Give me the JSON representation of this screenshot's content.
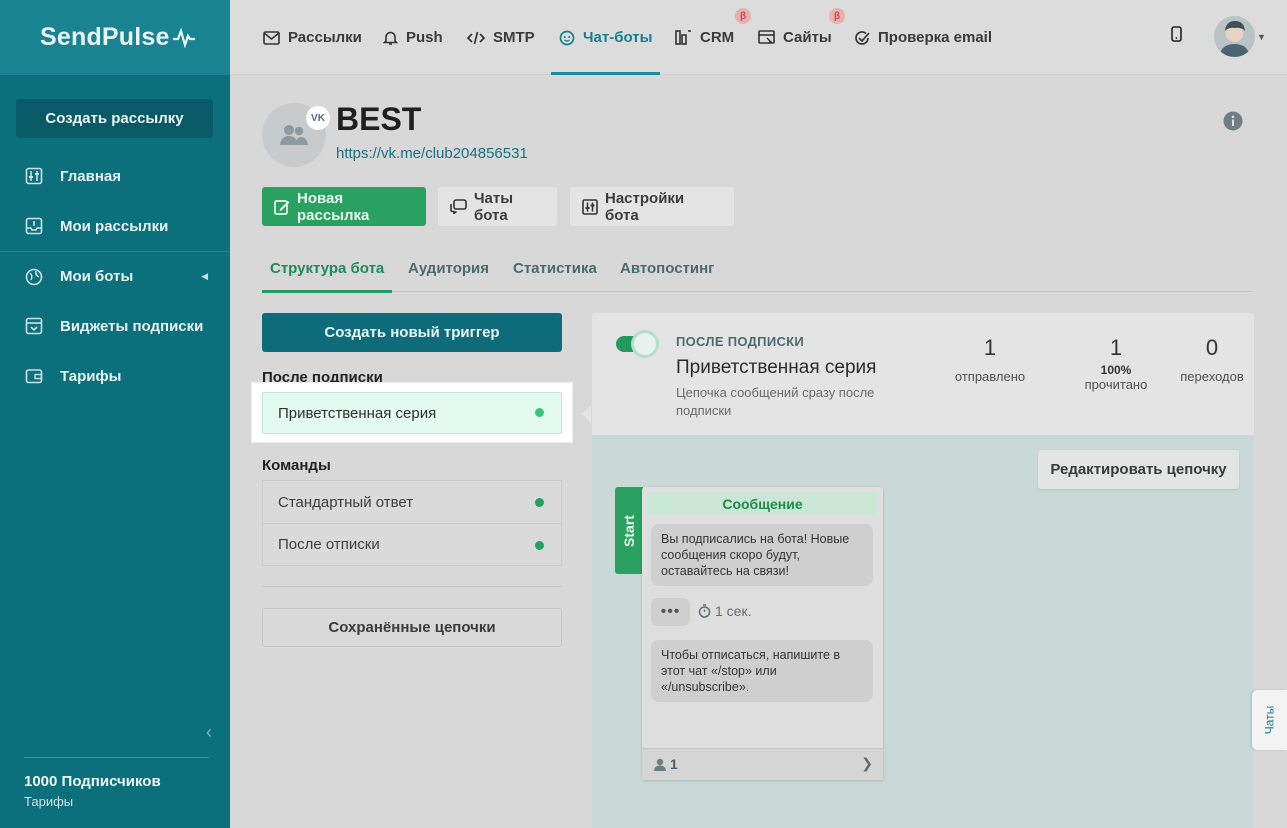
{
  "sidebar": {
    "logo": "SendPulse",
    "create_button": "Создать рассылку",
    "items": [
      {
        "label": "Главная",
        "icon": "sliders-icon"
      },
      {
        "label": "Мои рассылки",
        "icon": "inbox-icon"
      },
      {
        "label": "Мои боты",
        "icon": "globe-icon"
      },
      {
        "label": "Виджеты подписки",
        "icon": "widget-icon"
      },
      {
        "label": "Тарифы",
        "icon": "wallet-icon"
      }
    ],
    "subscribers": "1000 Подписчиков",
    "plan_link": "Тарифы"
  },
  "topnav": {
    "items": [
      {
        "label": "Рассылки",
        "icon": "mail-icon"
      },
      {
        "label": "Push",
        "icon": "bell-icon"
      },
      {
        "label": "SMTP",
        "icon": "code-icon"
      },
      {
        "label": "Чат-боты",
        "icon": "chatbot-icon",
        "active": true
      },
      {
        "label": "CRM",
        "icon": "crm-icon",
        "beta": "β"
      },
      {
        "label": "Сайты",
        "icon": "site-icon",
        "beta": "β"
      },
      {
        "label": "Проверка email",
        "icon": "check-icon"
      }
    ]
  },
  "bot": {
    "name": "BEST",
    "link": "https://vk.me/club204856531",
    "network_badge": "VK"
  },
  "actions": {
    "new_campaign": "Новая рассылка",
    "bot_chats": "Чаты бота",
    "bot_settings": "Настройки бота"
  },
  "tabs": [
    "Структура бота",
    "Аудитория",
    "Статистика",
    "Автопостинг"
  ],
  "triggers": {
    "create_button": "Создать новый триггер",
    "after_subscribe_label": "После подписки",
    "after_subscribe_items": [
      "Приветственная серия"
    ],
    "commands_label": "Команды",
    "commands_items": [
      "Стандартный ответ",
      "После отписки"
    ],
    "saved_chains": "Сохранённые цепочки"
  },
  "panel": {
    "caption": "ПОСЛЕ ПОДПИСКИ",
    "title": "Приветственная серия",
    "description": "Цепочка сообщений сразу после подписки",
    "stats": [
      {
        "value": "1",
        "label": "отправлено"
      },
      {
        "value": "1",
        "pct": "100%",
        "label": "прочитано"
      },
      {
        "value": "0",
        "label": "переходов"
      }
    ],
    "edit_button": "Редактировать цепочку",
    "start_label": "Start",
    "card": {
      "header": "Сообщение",
      "message1": "Вы подписались на бота! Новые сообщения скоро будут, оставайтесь на связи!",
      "typing": "•••",
      "delay": "1 сек.",
      "message2": "Чтобы отписаться, напишите в этот чат «/stop» или «/unsubscribe».",
      "subscribers_count": "1"
    }
  },
  "chats_side_tab": "Чаты",
  "colors": {
    "sidebar": "#0b6f7c",
    "accent_green": "#2aa160",
    "accent_teal": "#157f8d"
  }
}
